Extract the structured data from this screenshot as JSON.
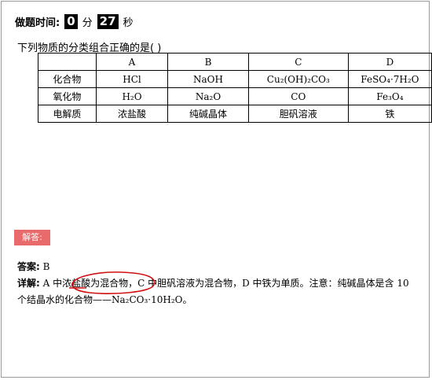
{
  "timer": {
    "label": "做题时间:",
    "minutes": "0",
    "minute_unit": "分",
    "seconds": "27",
    "second_unit": "秒"
  },
  "question": {
    "text": "下列物质的分类组合正确的是(      )"
  },
  "table": {
    "headers": [
      "",
      "A",
      "B",
      "C",
      "D"
    ],
    "rows": [
      {
        "label": "化合物",
        "a": "HCl",
        "b": "NaOH",
        "c": "Cu₂(OH)₂CO₃",
        "d": "FeSO₄·7H₂O"
      },
      {
        "label": "氧化物",
        "a": "H₂O",
        "b": "Na₂O",
        "c": "CO",
        "d": "Fe₃O₄"
      },
      {
        "label": "电解质",
        "a": "浓盐酸",
        "b": "纯碱晶体",
        "c": "胆矾溶液",
        "d": "铁"
      }
    ]
  },
  "answer_button": {
    "label": "解答:"
  },
  "answer": {
    "label": "答案:",
    "value": "B"
  },
  "explanation": {
    "label": "详解:",
    "text": "A 中浓盐酸为混合物，C 中胆矾溶液为混合物，D 中铁为单质。注意：纯碱晶体是含 10 个结晶水的化合物——Na₂CO₃·10H₂O。"
  },
  "colors": {
    "answer_button_bg": "#e96a6a",
    "annotation": "#d01010"
  }
}
